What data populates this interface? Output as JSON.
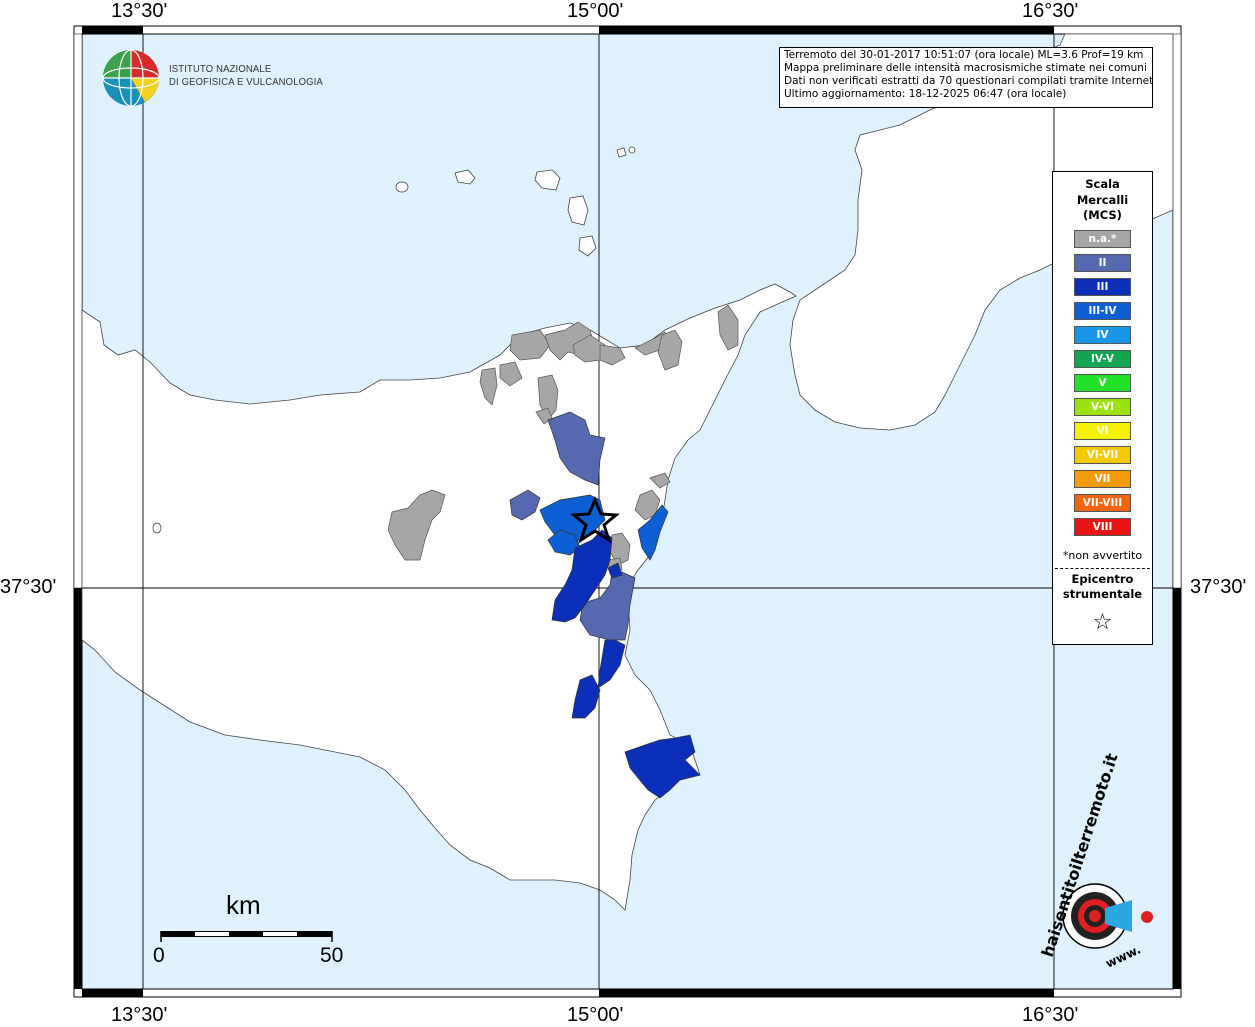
{
  "coords": {
    "top": [
      "13°30'",
      "15°00'",
      "16°30'"
    ],
    "bottom": [
      "13°30'",
      "15°00'",
      "16°30'"
    ],
    "left": "37°30'",
    "right": "37°30'"
  },
  "info": {
    "line1": "Terremoto del 30-01-2017 10:51:07 (ora locale) ML=3.6 Prof=19 km",
    "line2": "Mappa preliminare delle intensità macrosismiche stimate nei comuni",
    "line3": "Dati non verificati estratti da 70 questionari compilati tramite Internet.",
    "line4": "Ultimo aggiornamento: 18-12-2025 06:47 (ora locale)"
  },
  "logo": {
    "line1": "ISTITUTO NAZIONALE",
    "line2": "DI GEOFISICA E VULCANOLOGIA",
    "badge_text": "haisentitoilterremoto.it",
    "badge_url": "www."
  },
  "legend": {
    "title1": "Scala",
    "title2": "Mercalli",
    "title3": "(MCS)",
    "items": [
      {
        "label": "n.a.*",
        "color": "#a6a6a6"
      },
      {
        "label": "II",
        "color": "#5569b0"
      },
      {
        "label": "III",
        "color": "#0b2fb8"
      },
      {
        "label": "III-IV",
        "color": "#0d5fd4"
      },
      {
        "label": "IV",
        "color": "#1795e6"
      },
      {
        "label": "IV-V",
        "color": "#13a652"
      },
      {
        "label": "V",
        "color": "#22e22a"
      },
      {
        "label": "V-VI",
        "color": "#9be20f"
      },
      {
        "label": "VI",
        "color": "#f5f200"
      },
      {
        "label": "VI-VII",
        "color": "#f5c900"
      },
      {
        "label": "VII",
        "color": "#f59a0a"
      },
      {
        "label": "VII-VIII",
        "color": "#f2650d"
      },
      {
        "label": "VIII",
        "color": "#eb1414"
      }
    ],
    "note": "*non avvertito",
    "epicentro1": "Epicentro",
    "epicentro2": "strumentale",
    "star": "☆"
  },
  "scale": {
    "unit": "km",
    "start": "0",
    "end": "50"
  },
  "colors": {
    "sea": "#dff1fc",
    "land": "#ffffff",
    "border": "#000000",
    "na": "#a6a6a6",
    "II": "#5569b0",
    "III": "#0b2fb8",
    "III-IV": "#0d5fd4"
  }
}
